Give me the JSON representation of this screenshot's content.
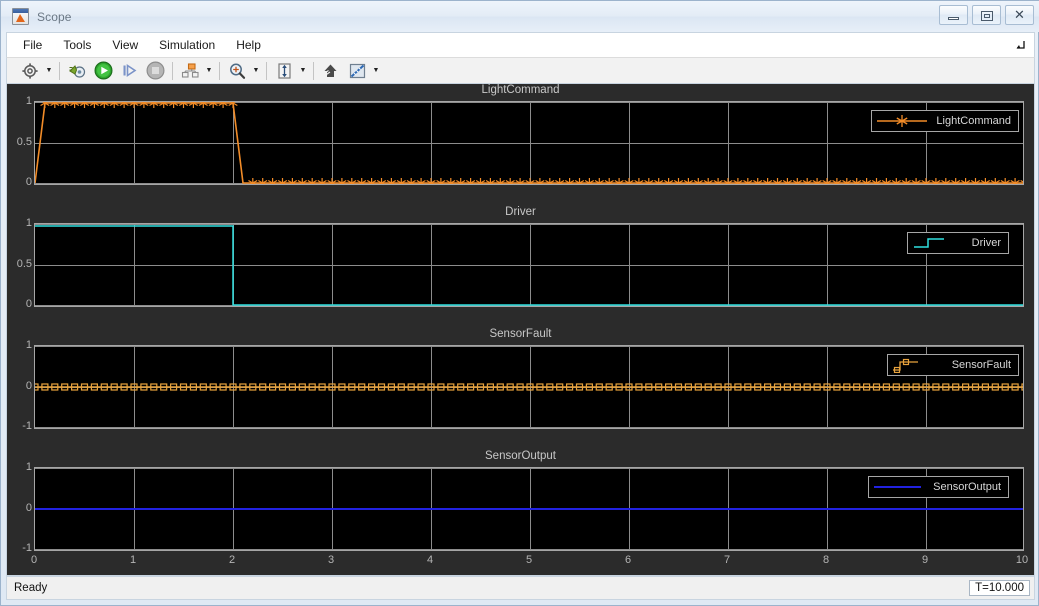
{
  "window": {
    "title": "Scope",
    "icon": "matlab-scope-icon",
    "buttons": {
      "minimize": "minimize-button",
      "maximize": "maximize-button",
      "close": "close-button"
    }
  },
  "menubar": {
    "items": [
      {
        "label": "File"
      },
      {
        "label": "Tools"
      },
      {
        "label": "View"
      },
      {
        "label": "Simulation"
      },
      {
        "label": "Help"
      }
    ],
    "expand_icon": "expand-arrow-icon"
  },
  "toolbar": {
    "groups": [
      {
        "buttons": [
          {
            "name": "configuration-properties-button",
            "icon": "gear-icon",
            "has_dropdown": true
          }
        ]
      },
      {
        "buttons": [
          {
            "name": "update-model-button",
            "icon": "update-diagram-icon",
            "has_dropdown": false
          },
          {
            "name": "run-button",
            "icon": "play-icon",
            "has_dropdown": false
          },
          {
            "name": "step-forward-button",
            "icon": "step-forward-icon",
            "has_dropdown": false
          },
          {
            "name": "stop-button",
            "icon": "stop-icon",
            "has_dropdown": false
          }
        ]
      },
      {
        "buttons": [
          {
            "name": "layout-button",
            "icon": "layout-icon",
            "has_dropdown": true
          }
        ]
      },
      {
        "buttons": [
          {
            "name": "zoom-button",
            "icon": "zoom-in-icon",
            "has_dropdown": true
          }
        ]
      },
      {
        "buttons": [
          {
            "name": "autoscale-button",
            "icon": "autoscale-icon",
            "has_dropdown": true
          }
        ]
      },
      {
        "buttons": [
          {
            "name": "highlight-signal-button",
            "icon": "highlight-signal-icon",
            "has_dropdown": false
          },
          {
            "name": "measurements-button",
            "icon": "measurements-icon",
            "has_dropdown": true
          }
        ]
      }
    ]
  },
  "statusbar": {
    "status": "Ready",
    "sim_time": "T=10.000"
  },
  "colors": {
    "light_command": "#f28c28",
    "driver": "#2fe0e0",
    "sensor_fault": "#e8a33d",
    "sensor_output": "#2222e0",
    "axes_background": "#000000",
    "canvas_background": "#2b2b2b",
    "grid": "#8c8c8c",
    "tick_text": "#b4b4b4"
  },
  "chart_data": [
    {
      "type": "line",
      "title": "LightCommand",
      "legend": [
        "LightCommand"
      ],
      "legend_position": "top-right",
      "xlabel": "",
      "ylabel": "",
      "xlim": [
        0,
        10
      ],
      "ylim": [
        0,
        1
      ],
      "xticks": [
        0,
        1,
        2,
        3,
        4,
        5,
        6,
        7,
        8,
        9,
        10
      ],
      "yticks": [
        0,
        0.5,
        1
      ],
      "ytick_labels": [
        "0",
        "0.5",
        "1"
      ],
      "grid": true,
      "marker": "asterisk",
      "color": "#f28c28",
      "series": [
        {
          "name": "LightCommand",
          "x": [
            0,
            0.1,
            2,
            2.05,
            10
          ],
          "values": [
            0,
            1,
            1,
            0,
            0
          ],
          "description": "Steps from 0 to 1 near t=0, stays 1 until t=2, then drops to 0 for the rest of the run"
        }
      ]
    },
    {
      "type": "line",
      "title": "Driver",
      "legend": [
        "Driver"
      ],
      "legend_position": "top-right",
      "xlabel": "",
      "ylabel": "",
      "xlim": [
        0,
        10
      ],
      "ylim": [
        0,
        1
      ],
      "xticks": [
        0,
        1,
        2,
        3,
        4,
        5,
        6,
        7,
        8,
        9,
        10
      ],
      "yticks": [
        0,
        0.5,
        1
      ],
      "ytick_labels": [
        "0",
        "0.5",
        "1"
      ],
      "grid": true,
      "marker": "none",
      "color": "#2fe0e0",
      "series": [
        {
          "name": "Driver",
          "x": [
            0,
            2,
            2,
            10
          ],
          "values": [
            1,
            1,
            0,
            0
          ],
          "description": "Holds 1 from t=0 to t=2 then steps down to 0"
        }
      ]
    },
    {
      "type": "line",
      "title": "SensorFault",
      "legend": [
        "SensorFault"
      ],
      "legend_position": "top-right",
      "xlabel": "",
      "ylabel": "",
      "xlim": [
        0,
        10
      ],
      "ylim": [
        -1,
        1
      ],
      "xticks": [
        0,
        1,
        2,
        3,
        4,
        5,
        6,
        7,
        8,
        9,
        10
      ],
      "yticks": [
        -1,
        0,
        1
      ],
      "ytick_labels": [
        "-1",
        "0",
        "1"
      ],
      "grid": true,
      "marker": "square",
      "color": "#e8a33d",
      "series": [
        {
          "name": "SensorFault",
          "x": [
            0,
            10
          ],
          "values": [
            0,
            0
          ],
          "description": "Constant 0 across the whole run with square markers"
        }
      ]
    },
    {
      "type": "line",
      "title": "SensorOutput",
      "legend": [
        "SensorOutput"
      ],
      "legend_position": "top-right",
      "xlabel": "",
      "ylabel": "",
      "xlim": [
        0,
        10
      ],
      "ylim": [
        -1,
        1
      ],
      "xticks": [
        0,
        1,
        2,
        3,
        4,
        5,
        6,
        7,
        8,
        9,
        10
      ],
      "xtick_labels": [
        "0",
        "1",
        "2",
        "3",
        "4",
        "5",
        "6",
        "7",
        "8",
        "9",
        "10"
      ],
      "yticks": [
        -1,
        0,
        1
      ],
      "ytick_labels": [
        "-1",
        "0",
        "1"
      ],
      "grid": true,
      "marker": "none",
      "color": "#2222e0",
      "series": [
        {
          "name": "SensorOutput",
          "x": [
            0,
            10
          ],
          "values": [
            0,
            0
          ],
          "description": "Constant 0 across the whole run"
        }
      ]
    }
  ]
}
